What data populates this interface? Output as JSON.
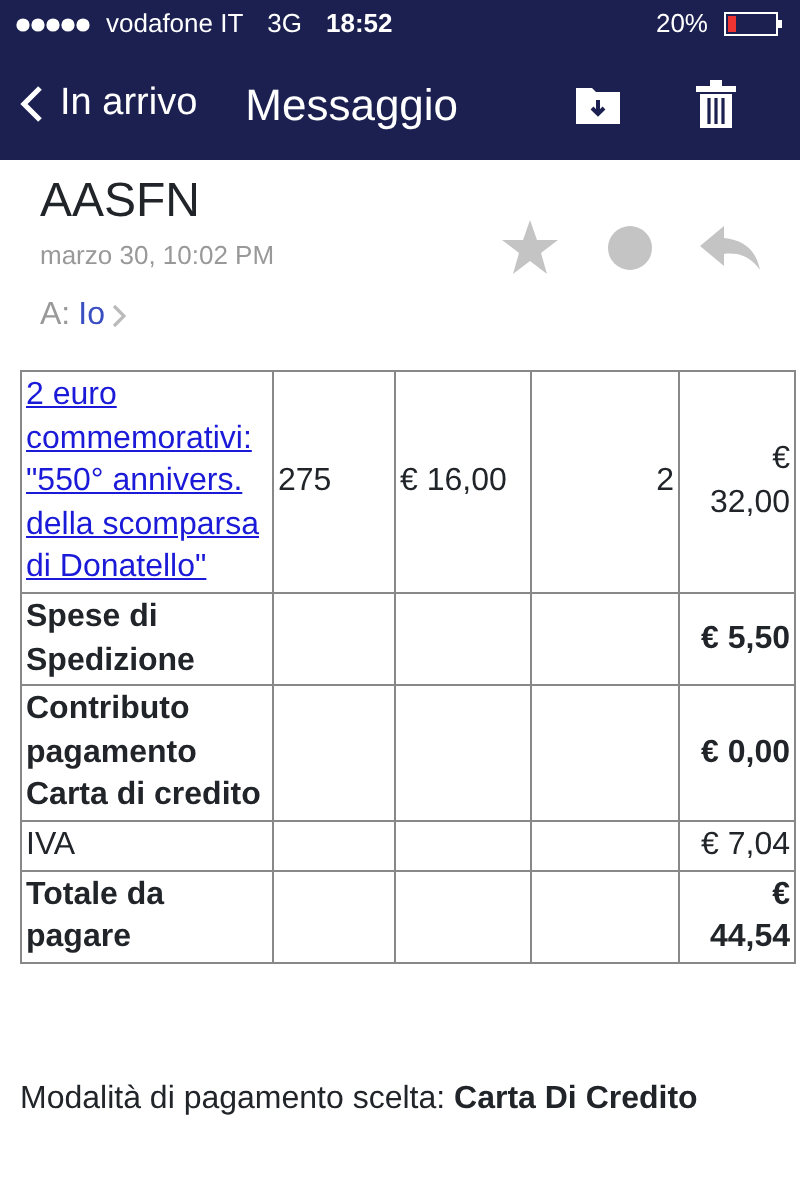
{
  "status_bar": {
    "carrier": "vodafone IT",
    "network": "3G",
    "time": "18:52",
    "battery": "20%"
  },
  "nav_bar": {
    "back": "In arrivo",
    "title": "Messaggio"
  },
  "message": {
    "sender": "AASFN",
    "date": "marzo 30, 10:02 PM",
    "to_label": "A:",
    "to": "Io"
  },
  "table": {
    "rows": [
      {
        "kind": "item",
        "description": "2 euro commemorativi: \"550° annivers. della scomparsa di Donatello\"",
        "code": "275",
        "price": "€ 16,00",
        "quantity": "2",
        "total": "€ 32,00"
      },
      {
        "kind": "summary",
        "bold": true,
        "label": "Spese di Spedizione",
        "total": "€ 5,50"
      },
      {
        "kind": "summary",
        "bold": true,
        "label": "Contributo pagamento Carta di credito",
        "total": "€ 0,00"
      },
      {
        "kind": "summary",
        "bold": false,
        "label": "IVA",
        "total": "€ 7,04"
      },
      {
        "kind": "summary",
        "bold": true,
        "label": "Totale da pagare",
        "total": "€ 44,54"
      }
    ]
  },
  "payment": "Modalità di pagamento scelta: **Carta Di Credito**"
}
